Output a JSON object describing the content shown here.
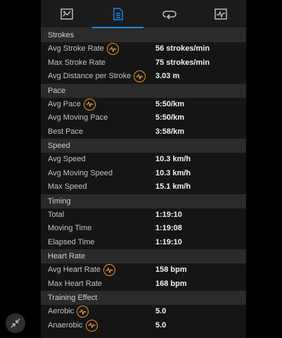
{
  "tabs": [
    {
      "icon": "summary-chart-icon",
      "active": false
    },
    {
      "icon": "stats-list-icon",
      "active": true
    },
    {
      "icon": "laps-icon",
      "active": false
    },
    {
      "icon": "graph-icon",
      "active": false
    }
  ],
  "accent_color": "#1e88e5",
  "chart_badge_color": "#e8943a",
  "sections": [
    {
      "title": "Strokes",
      "rows": [
        {
          "label": "Avg Stroke Rate",
          "value": "56 strokes/min",
          "chart_icon": true
        },
        {
          "label": "Max Stroke Rate",
          "value": "75 strokes/min",
          "chart_icon": false
        },
        {
          "label": "Avg Distance per Stroke",
          "value": "3.03 m",
          "chart_icon": true
        }
      ]
    },
    {
      "title": "Pace",
      "rows": [
        {
          "label": "Avg Pace",
          "value": "5:50/km",
          "chart_icon": true
        },
        {
          "label": "Avg Moving Pace",
          "value": "5:50/km",
          "chart_icon": false
        },
        {
          "label": "Best Pace",
          "value": "3:58/km",
          "chart_icon": false
        }
      ]
    },
    {
      "title": "Speed",
      "rows": [
        {
          "label": "Avg Speed",
          "value": "10.3 km/h",
          "chart_icon": false
        },
        {
          "label": "Avg Moving Speed",
          "value": "10.3 km/h",
          "chart_icon": false
        },
        {
          "label": "Max Speed",
          "value": "15.1 km/h",
          "chart_icon": false
        }
      ]
    },
    {
      "title": "Timing",
      "rows": [
        {
          "label": "Total",
          "value": "1:19:10",
          "chart_icon": false
        },
        {
          "label": "Moving Time",
          "value": "1:19:08",
          "chart_icon": false
        },
        {
          "label": "Elapsed Time",
          "value": "1:19:10",
          "chart_icon": false
        }
      ]
    },
    {
      "title": "Heart Rate",
      "rows": [
        {
          "label": "Avg Heart Rate",
          "value": "158 bpm",
          "chart_icon": true
        },
        {
          "label": "Max Heart Rate",
          "value": "168 bpm",
          "chart_icon": false
        }
      ]
    },
    {
      "title": "Training Effect",
      "rows": [
        {
          "label": "Aerobic",
          "value": "5.0",
          "chart_icon": true
        },
        {
          "label": "Anaerobic",
          "value": "5.0",
          "chart_icon": true
        }
      ]
    }
  ],
  "collapse_button": {
    "icon": "collapse-arrows-icon"
  }
}
